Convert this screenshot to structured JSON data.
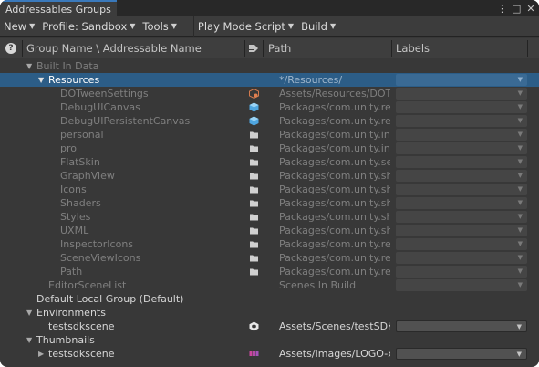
{
  "window": {
    "tab_title": "Addressables Groups",
    "controls": {
      "menu_glyph": "⋮",
      "maximize_glyph": "□",
      "close_glyph": "✕"
    }
  },
  "toolbar": {
    "new_label": "New",
    "profile_label": "Profile: Sandbox",
    "tools_label": "Tools",
    "play_mode_label": "Play Mode Script",
    "build_label": "Build"
  },
  "header": {
    "group_name": "Group Name \\ Addressable Name",
    "path": "Path",
    "labels": "Labels"
  },
  "colors": {
    "accent": "#2c5d87",
    "tab_highlight": "#3a79bb",
    "background": "#383838"
  },
  "rows": [
    {
      "name": "Built In Data",
      "path": "",
      "icon": "",
      "indent": 40,
      "arrow": "▼",
      "style": "dim"
    },
    {
      "name": "Resources",
      "path": "*/Resources/",
      "icon": "",
      "indent": 53,
      "arrow": "▼",
      "style": "sel",
      "label": true
    },
    {
      "name": "DOTweenSettings",
      "path": "Assets/Resources/DOT",
      "icon": "scriptable-object-icon",
      "indent": 66,
      "style": "dim",
      "label": true
    },
    {
      "name": "DebugUICanvas",
      "path": "Packages/com.unity.re",
      "icon": "prefab-icon",
      "indent": 66,
      "style": "dim",
      "label": true
    },
    {
      "name": "DebugUIPersistentCanvas",
      "path": "Packages/com.unity.re",
      "icon": "prefab-icon",
      "indent": 66,
      "style": "dim",
      "label": true
    },
    {
      "name": "personal",
      "path": "Packages/com.unity.in",
      "icon": "folder-icon",
      "indent": 66,
      "style": "dim",
      "label": true
    },
    {
      "name": "pro",
      "path": "Packages/com.unity.in",
      "icon": "folder-icon",
      "indent": 66,
      "style": "dim",
      "label": true
    },
    {
      "name": "FlatSkin",
      "path": "Packages/com.unity.se",
      "icon": "folder-icon",
      "indent": 66,
      "style": "dim",
      "label": true
    },
    {
      "name": "GraphView",
      "path": "Packages/com.unity.sh",
      "icon": "folder-icon",
      "indent": 66,
      "style": "dim",
      "label": true
    },
    {
      "name": "Icons",
      "path": "Packages/com.unity.sh",
      "icon": "folder-icon",
      "indent": 66,
      "style": "dim",
      "label": true
    },
    {
      "name": "Shaders",
      "path": "Packages/com.unity.sh",
      "icon": "folder-icon",
      "indent": 66,
      "style": "dim",
      "label": true
    },
    {
      "name": "Styles",
      "path": "Packages/com.unity.sh",
      "icon": "folder-icon",
      "indent": 66,
      "style": "dim",
      "label": true
    },
    {
      "name": "UXML",
      "path": "Packages/com.unity.sh",
      "icon": "folder-icon",
      "indent": 66,
      "style": "dim",
      "label": true
    },
    {
      "name": "InspectorIcons",
      "path": "Packages/com.unity.re",
      "icon": "folder-icon",
      "indent": 66,
      "style": "dim",
      "label": true
    },
    {
      "name": "SceneViewIcons",
      "path": "Packages/com.unity.re",
      "icon": "folder-icon",
      "indent": 66,
      "style": "dim",
      "label": true
    },
    {
      "name": "Path",
      "path": "Packages/com.unity.re",
      "icon": "folder-icon",
      "indent": 66,
      "style": "dim",
      "label": true
    },
    {
      "name": "EditorSceneList",
      "path": "Scenes In Build",
      "icon": "",
      "indent": 53,
      "style": "dim",
      "label": true
    },
    {
      "name": "Default Local Group (Default)",
      "path": "",
      "icon": "",
      "indent": 40,
      "style": "bright"
    },
    {
      "name": "Environments",
      "path": "",
      "icon": "",
      "indent": 40,
      "arrow": "▼",
      "style": "bright"
    },
    {
      "name": "testsdkscene",
      "path": "Assets/Scenes/testSDK",
      "icon": "unity-scene-icon",
      "indent": 53,
      "style": "bright",
      "label": true,
      "active": true
    },
    {
      "name": "Thumbnails",
      "path": "",
      "icon": "",
      "indent": 40,
      "arrow": "▼",
      "style": "bright"
    },
    {
      "name": "testsdkscene",
      "path": "Assets/Images/LOGO-x",
      "icon": "sprite-icon",
      "indent": 53,
      "arrow": "▶",
      "style": "bright",
      "label": true,
      "active": true
    }
  ]
}
